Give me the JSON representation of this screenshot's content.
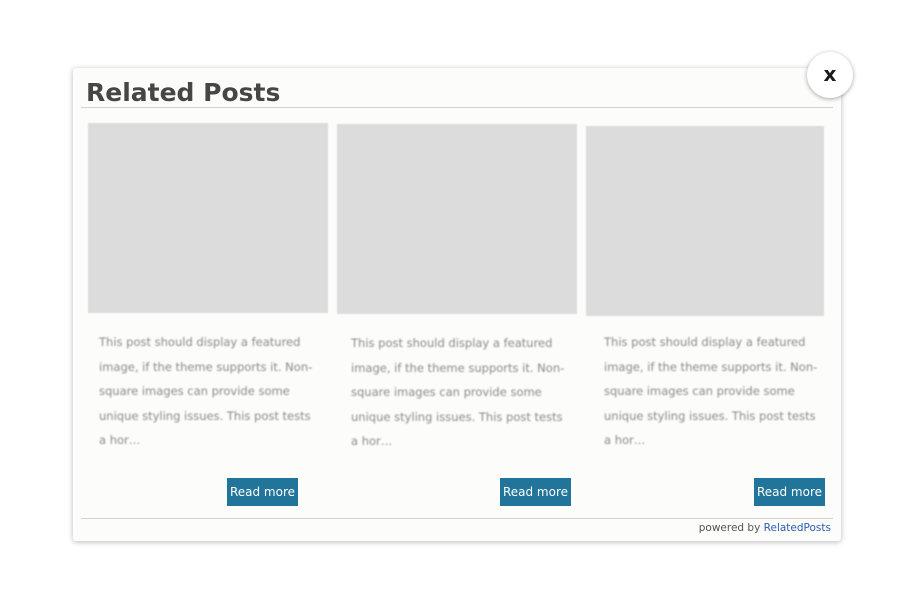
{
  "modal": {
    "title": "Related Posts",
    "close_label": "x"
  },
  "posts": [
    {
      "excerpt": "This post should display a featured image, if the theme supports it. Non-square images can provide some unique styling issues. This post tests a hor…",
      "read_more_label": "Read more"
    },
    {
      "excerpt": "This post should display a featured image, if the theme supports it. Non-square images can provide some unique styling issues. This post tests a hor…",
      "read_more_label": "Read more"
    },
    {
      "excerpt": "This post should display a featured image, if the theme supports it. Non-square images can provide some unique styling issues. This post tests a hor…",
      "read_more_label": "Read more"
    }
  ],
  "footer": {
    "powered_by_text": "powered by",
    "link_text": "RelatedPosts"
  },
  "colors": {
    "button": "#21759b",
    "thumbnail_placeholder": "#dcdcdc",
    "link": "#2a5db0"
  }
}
